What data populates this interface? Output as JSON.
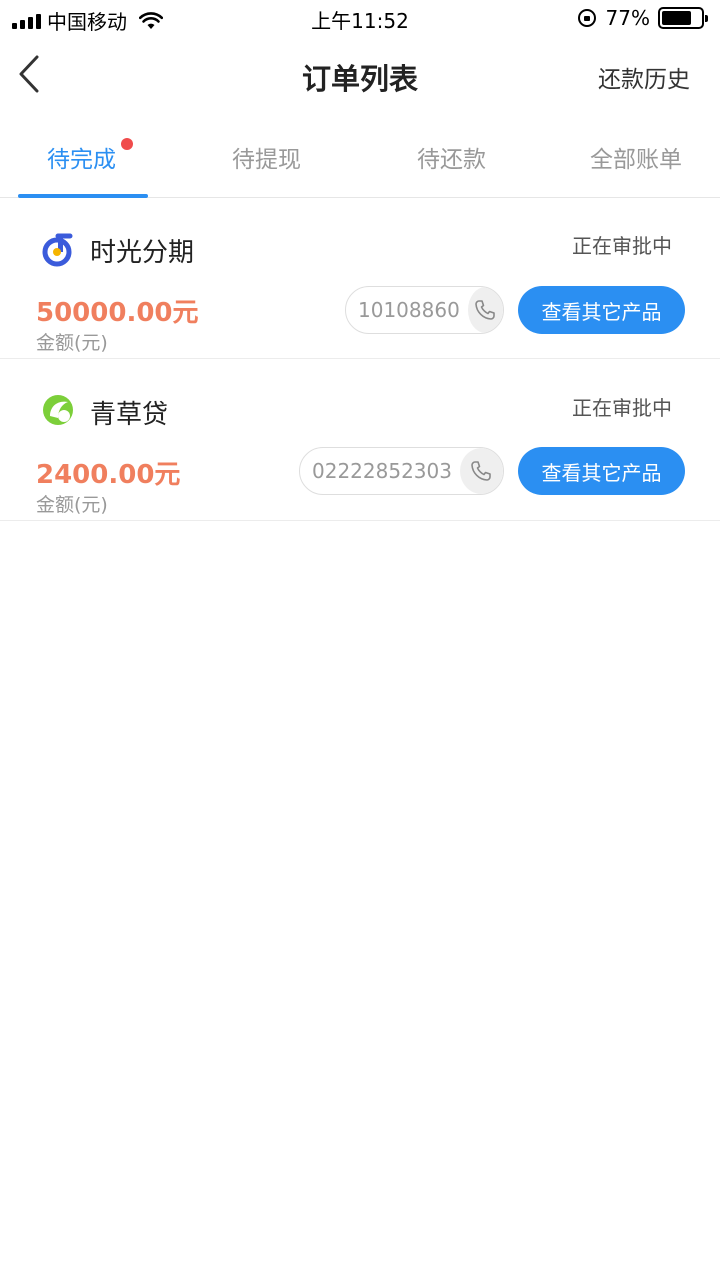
{
  "status_bar": {
    "carrier": "中国移动",
    "time": "上午11:52",
    "battery": "77%",
    "battery_level": 0.77
  },
  "nav": {
    "title": "订单列表",
    "action": "还款历史"
  },
  "tabs": [
    {
      "label": "待完成",
      "active": true,
      "has_dot": true
    },
    {
      "label": "待提现",
      "active": false
    },
    {
      "label": "待还款",
      "active": false
    },
    {
      "label": "全部账单",
      "active": false
    }
  ],
  "orders": [
    {
      "name": "时光分期",
      "status": "正在审批中",
      "amount": "50000.00元",
      "amount_label": "金额(元)",
      "phone": "10108860",
      "button": "查看其它产品",
      "logo_icon": "shiguang-logo-icon"
    },
    {
      "name": "青草贷",
      "status": "正在审批中",
      "amount": "2400.00元",
      "amount_label": "金额(元)",
      "phone": "02222852303",
      "button": "查看其它产品",
      "logo_icon": "qingcao-logo-icon"
    }
  ],
  "colors": {
    "accent": "#2b8ff2",
    "amount": "#f07f5e",
    "dot": "#f04b4b"
  }
}
